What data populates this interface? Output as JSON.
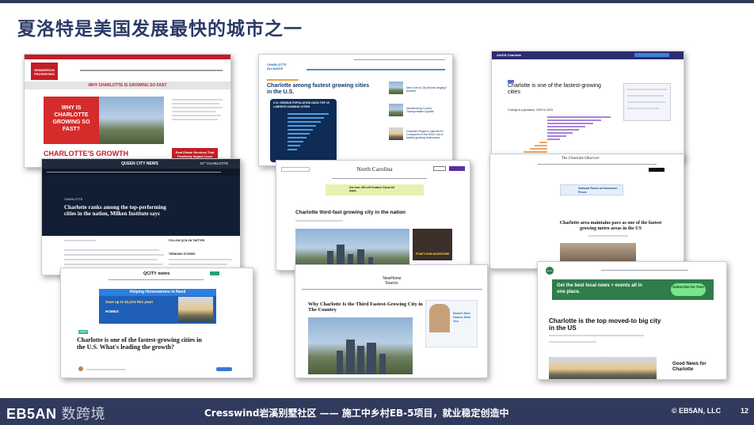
{
  "slide": {
    "title": "夏洛特是美国发展最快的城市之一",
    "footer_logo": "EB5AN",
    "footer_logo_cn": "数跨境",
    "footer_center": "Cresswind岩溪别墅社区 —— 施工中乡村EB-5项目，就业稳定创造中",
    "copyright": "© EB5AN, LLC",
    "page_number": "12"
  },
  "articles": {
    "a1": {
      "site": "HENDERSON PROPERTIES",
      "banner": "WHY CHARLOTTE IS GROWING SO FAST",
      "box": "WHY IS CHARLOTTE GROWING SO FAST?",
      "headline": "CHARLOTTE'S GROWTH EXPLAINED",
      "side_button": "Real Estate Services That Positively Impact Lives"
    },
    "a2": {
      "site": "CHARLOTTE ALLIANCE",
      "headline": "Charlotte among fastest growing cities in the U.S.",
      "chart_title": "U.S. CENSUS POPULATION DATA TOP 10 LARGEST-GAINING CITIES",
      "side1": "New York to City Bonds ranging? Another",
      "side2": "Mecklenburg County Transportation Update",
      "side3": "Charlotte Region's Interest Ed Companies in the 5000 List of fastest-growing businesses"
    },
    "a3": {
      "site": "AXIOS Charlotte",
      "headline": "Charlotte is one of the fastest-growing cities",
      "chart_caption": "Change in population, 2020 to 2023"
    },
    "a4": {
      "site": "QUEEN CITY NEWS",
      "temp": "57° CHARLOTTE",
      "kicker": "CHARLOTTE",
      "headline": "Charlotte ranks among the top-performing cities in the nation, Milken Institute says",
      "side_title": "FOLLOW QCN ON TWITTER",
      "trending": "TRENDING STORIES"
    },
    "a5": {
      "site": "North Carolina",
      "ad": "Get over 45% off Creative Cloud All Apps.",
      "headline": "Charlotte third-fast growing city in the nation",
      "side_ad": "FOUR YOUR ADVENTURE"
    },
    "a6": {
      "site": "The Charlotte Observer",
      "ad": "National Reach at Hometown Prices",
      "headline": "Charlotte area maintains pace as one of the fastest growing metro areas in the US"
    },
    "a7": {
      "site": "QCITY metro",
      "ad_title": "Helping Homeowners in Need",
      "ad_line": "Save up to $1,214 this year!",
      "ad_brand": "HOMES",
      "tag": "NEWS",
      "headline": "Charlotte is one of the fastest-growing cities in the U.S. What's leading the growth?"
    },
    "a8": {
      "site": "NewHome Source.",
      "headline": "Why Charlotte Is the Third Fastest-Growing City in The Country",
      "side": "Search New Homes Near You"
    },
    "a9": {
      "site": "axios",
      "ad": "Get the best local news + events all in one place.",
      "ad_button": "Subscribe for free!",
      "headline": "Charlotte is the top moved-to big city in the US",
      "side_title": "Good News for Charlotte"
    }
  }
}
